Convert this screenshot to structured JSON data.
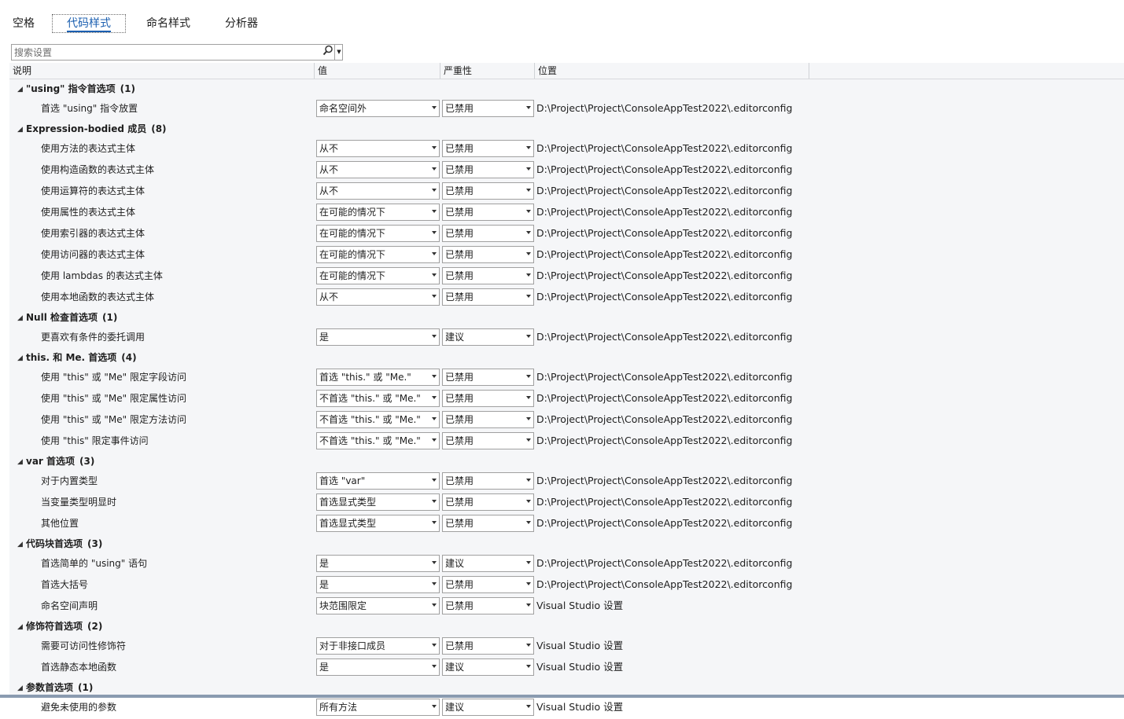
{
  "tabs": [
    {
      "label": "空格"
    },
    {
      "label": "代码样式"
    },
    {
      "label": "命名样式"
    },
    {
      "label": "分析器"
    }
  ],
  "search": {
    "placeholder": "搜索设置"
  },
  "columns": {
    "description": "说明",
    "value": "值",
    "severity": "严重性",
    "location": "位置"
  },
  "groups": [
    {
      "title": "\"using\" 指令首选项",
      "count": "(1)",
      "items": [
        {
          "desc": "首选 \"using\" 指令放置",
          "value": "命名空间外",
          "severity": "已禁用",
          "location": "D:\\Project\\Project\\ConsoleAppTest2022\\.editorconfig"
        }
      ]
    },
    {
      "title": "Expression-bodied 成员",
      "count": "(8)",
      "items": [
        {
          "desc": "使用方法的表达式主体",
          "value": "从不",
          "severity": "已禁用",
          "location": "D:\\Project\\Project\\ConsoleAppTest2022\\.editorconfig"
        },
        {
          "desc": "使用构造函数的表达式主体",
          "value": "从不",
          "severity": "已禁用",
          "location": "D:\\Project\\Project\\ConsoleAppTest2022\\.editorconfig"
        },
        {
          "desc": "使用运算符的表达式主体",
          "value": "从不",
          "severity": "已禁用",
          "location": "D:\\Project\\Project\\ConsoleAppTest2022\\.editorconfig"
        },
        {
          "desc": "使用属性的表达式主体",
          "value": "在可能的情况下",
          "severity": "已禁用",
          "location": "D:\\Project\\Project\\ConsoleAppTest2022\\.editorconfig"
        },
        {
          "desc": "使用索引器的表达式主体",
          "value": "在可能的情况下",
          "severity": "已禁用",
          "location": "D:\\Project\\Project\\ConsoleAppTest2022\\.editorconfig"
        },
        {
          "desc": "使用访问器的表达式主体",
          "value": "在可能的情况下",
          "severity": "已禁用",
          "location": "D:\\Project\\Project\\ConsoleAppTest2022\\.editorconfig"
        },
        {
          "desc": "使用 lambdas 的表达式主体",
          "value": "在可能的情况下",
          "severity": "已禁用",
          "location": "D:\\Project\\Project\\ConsoleAppTest2022\\.editorconfig"
        },
        {
          "desc": "使用本地函数的表达式主体",
          "value": "从不",
          "severity": "已禁用",
          "location": "D:\\Project\\Project\\ConsoleAppTest2022\\.editorconfig"
        }
      ]
    },
    {
      "title": "Null 检查首选项",
      "count": "(1)",
      "items": [
        {
          "desc": "更喜欢有条件的委托调用",
          "value": "是",
          "severity": "建议",
          "location": "D:\\Project\\Project\\ConsoleAppTest2022\\.editorconfig"
        }
      ]
    },
    {
      "title": "this. 和 Me. 首选项",
      "count": "(4)",
      "items": [
        {
          "desc": "使用 \"this\" 或 \"Me\" 限定字段访问",
          "value": "首选 \"this.\" 或 \"Me.\"",
          "severity": "已禁用",
          "location": "D:\\Project\\Project\\ConsoleAppTest2022\\.editorconfig"
        },
        {
          "desc": "使用 \"this\" 或 \"Me\" 限定属性访问",
          "value": "不首选 \"this.\" 或 \"Me.\"",
          "severity": "已禁用",
          "location": "D:\\Project\\Project\\ConsoleAppTest2022\\.editorconfig"
        },
        {
          "desc": "使用 \"this\" 或 \"Me\" 限定方法访问",
          "value": "不首选 \"this.\" 或 \"Me.\"",
          "severity": "已禁用",
          "location": "D:\\Project\\Project\\ConsoleAppTest2022\\.editorconfig"
        },
        {
          "desc": "使用 \"this\" 限定事件访问",
          "value": "不首选 \"this.\" 或 \"Me.\"",
          "severity": "已禁用",
          "location": "D:\\Project\\Project\\ConsoleAppTest2022\\.editorconfig"
        }
      ]
    },
    {
      "title": "var 首选项",
      "count": "(3)",
      "items": [
        {
          "desc": "对于内置类型",
          "value": "首选 \"var\"",
          "severity": "已禁用",
          "location": "D:\\Project\\Project\\ConsoleAppTest2022\\.editorconfig"
        },
        {
          "desc": "当变量类型明显时",
          "value": "首选显式类型",
          "severity": "已禁用",
          "location": "D:\\Project\\Project\\ConsoleAppTest2022\\.editorconfig"
        },
        {
          "desc": "其他位置",
          "value": "首选显式类型",
          "severity": "已禁用",
          "location": "D:\\Project\\Project\\ConsoleAppTest2022\\.editorconfig"
        }
      ]
    },
    {
      "title": "代码块首选项",
      "count": "(3)",
      "items": [
        {
          "desc": "首选简单的 \"using\" 语句",
          "value": "是",
          "severity": "建议",
          "location": "D:\\Project\\Project\\ConsoleAppTest2022\\.editorconfig"
        },
        {
          "desc": "首选大括号",
          "value": "是",
          "severity": "已禁用",
          "location": "D:\\Project\\Project\\ConsoleAppTest2022\\.editorconfig"
        },
        {
          "desc": "命名空间声明",
          "value": "块范围限定",
          "severity": "已禁用",
          "location": "Visual Studio 设置"
        }
      ]
    },
    {
      "title": "修饰符首选项",
      "count": "(2)",
      "items": [
        {
          "desc": "需要可访问性修饰符",
          "value": "对于非接口成员",
          "severity": "已禁用",
          "location": "Visual Studio 设置"
        },
        {
          "desc": "首选静态本地函数",
          "value": "是",
          "severity": "建议",
          "location": "Visual Studio 设置"
        }
      ]
    },
    {
      "title": "参数首选项",
      "count": "(1)",
      "items": [
        {
          "desc": "避免未使用的参数",
          "value": "所有方法",
          "severity": "建议",
          "location": "Visual Studio 设置"
        }
      ]
    }
  ],
  "icons": {
    "search": "search-icon",
    "dropdown": "chevron-down-icon",
    "expand": "collapse-triangle-icon"
  },
  "colors": {
    "active_tab": "#1b5fb0",
    "grid_bg": "#f5f6f8"
  }
}
